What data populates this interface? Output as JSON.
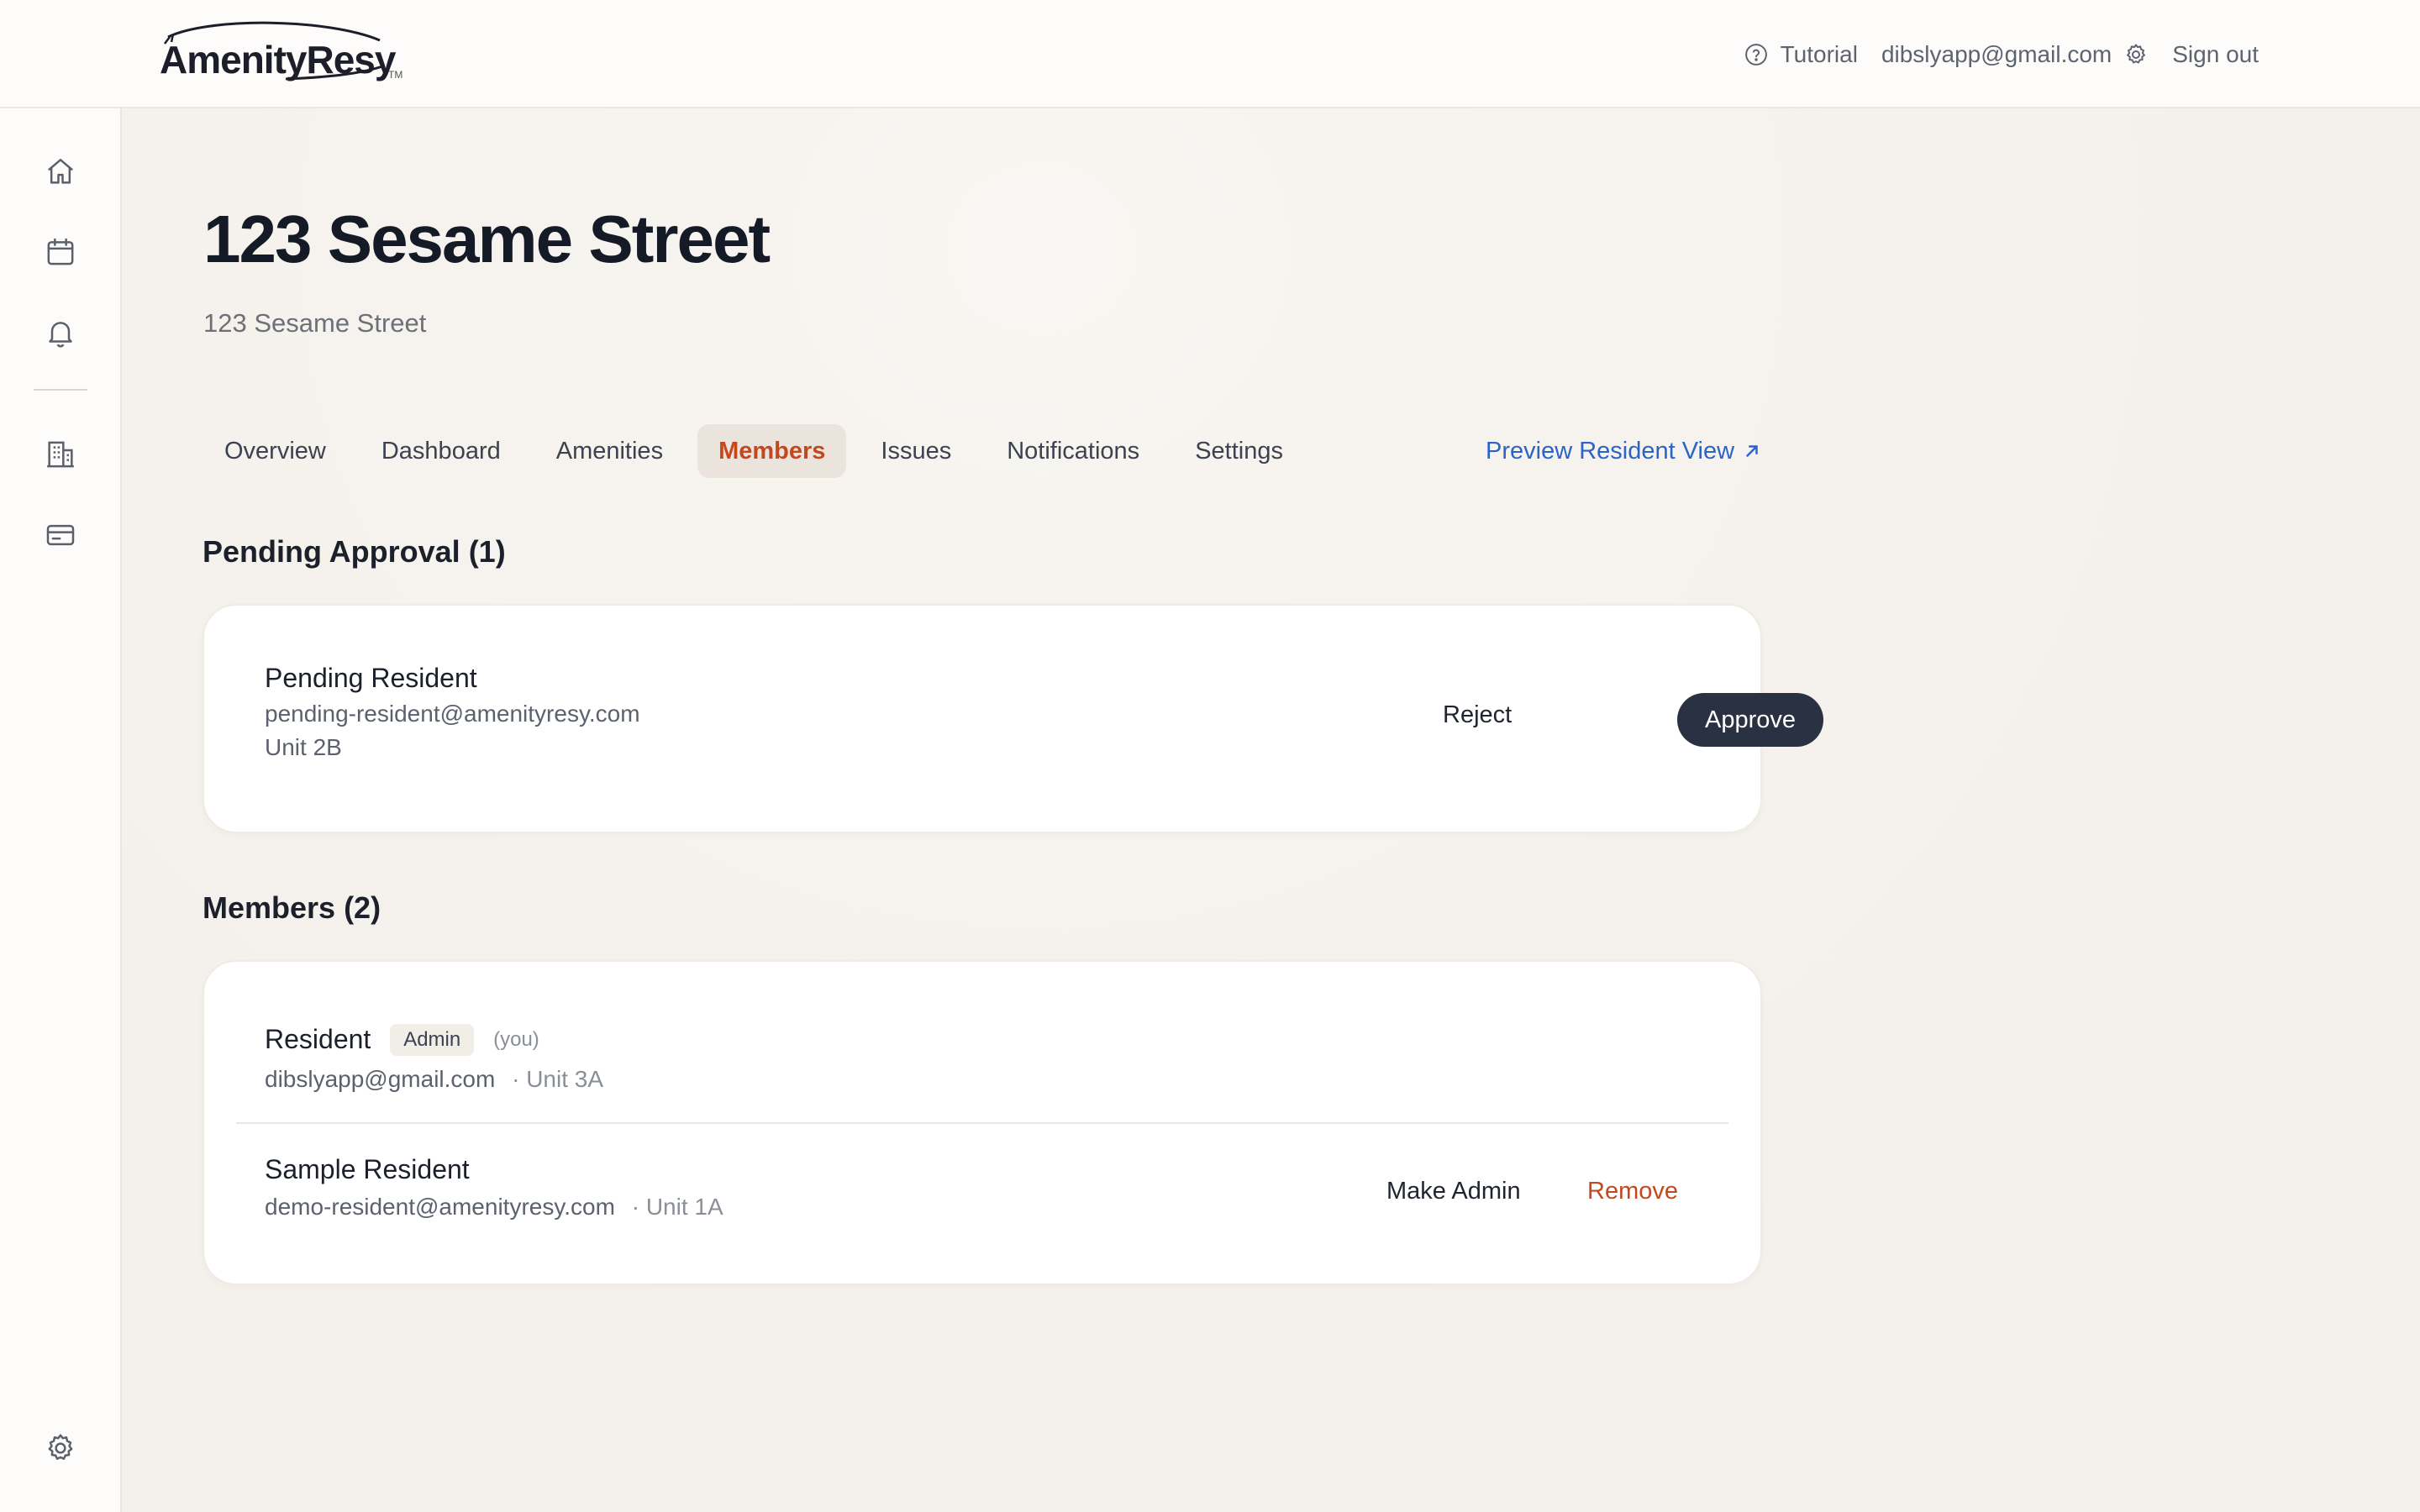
{
  "brand": {
    "name": "AmenityResy",
    "tm": "TM"
  },
  "header": {
    "tutorial_label": "Tutorial",
    "user_email": "dibslyapp@gmail.com",
    "signout_label": "Sign out"
  },
  "sidebar": {
    "icons": [
      "home-icon",
      "calendar-icon",
      "bell-icon",
      "building-icon",
      "credit-card-icon",
      "gear-icon"
    ]
  },
  "page": {
    "title": "123 Sesame Street",
    "subtitle": "123 Sesame Street"
  },
  "tabs": [
    {
      "label": "Overview"
    },
    {
      "label": "Dashboard"
    },
    {
      "label": "Amenities"
    },
    {
      "label": "Members",
      "active": true
    },
    {
      "label": "Issues"
    },
    {
      "label": "Notifications"
    },
    {
      "label": "Settings"
    }
  ],
  "preview_link": {
    "label": "Preview Resident View"
  },
  "pending": {
    "title": "Pending Approval (1)",
    "items": [
      {
        "name": "Pending Resident",
        "email": "pending-resident@amenityresy.com",
        "unit": "Unit 2B",
        "reject_label": "Reject",
        "approve_label": "Approve"
      }
    ]
  },
  "members": {
    "title": "Members (2)",
    "items": [
      {
        "name": "Resident",
        "badge": "Admin",
        "you": "(you)",
        "email": "dibslyapp@gmail.com",
        "unit": "· Unit 3A"
      },
      {
        "name": "Sample Resident",
        "email": "demo-resident@amenityresy.com",
        "unit": "· Unit 1A",
        "make_admin_label": "Make Admin",
        "remove_label": "Remove"
      }
    ]
  },
  "colors": {
    "accent": "#c4481f",
    "link": "#2b63c9",
    "dark_button": "#2a3142",
    "background": "#f5f1ec"
  }
}
